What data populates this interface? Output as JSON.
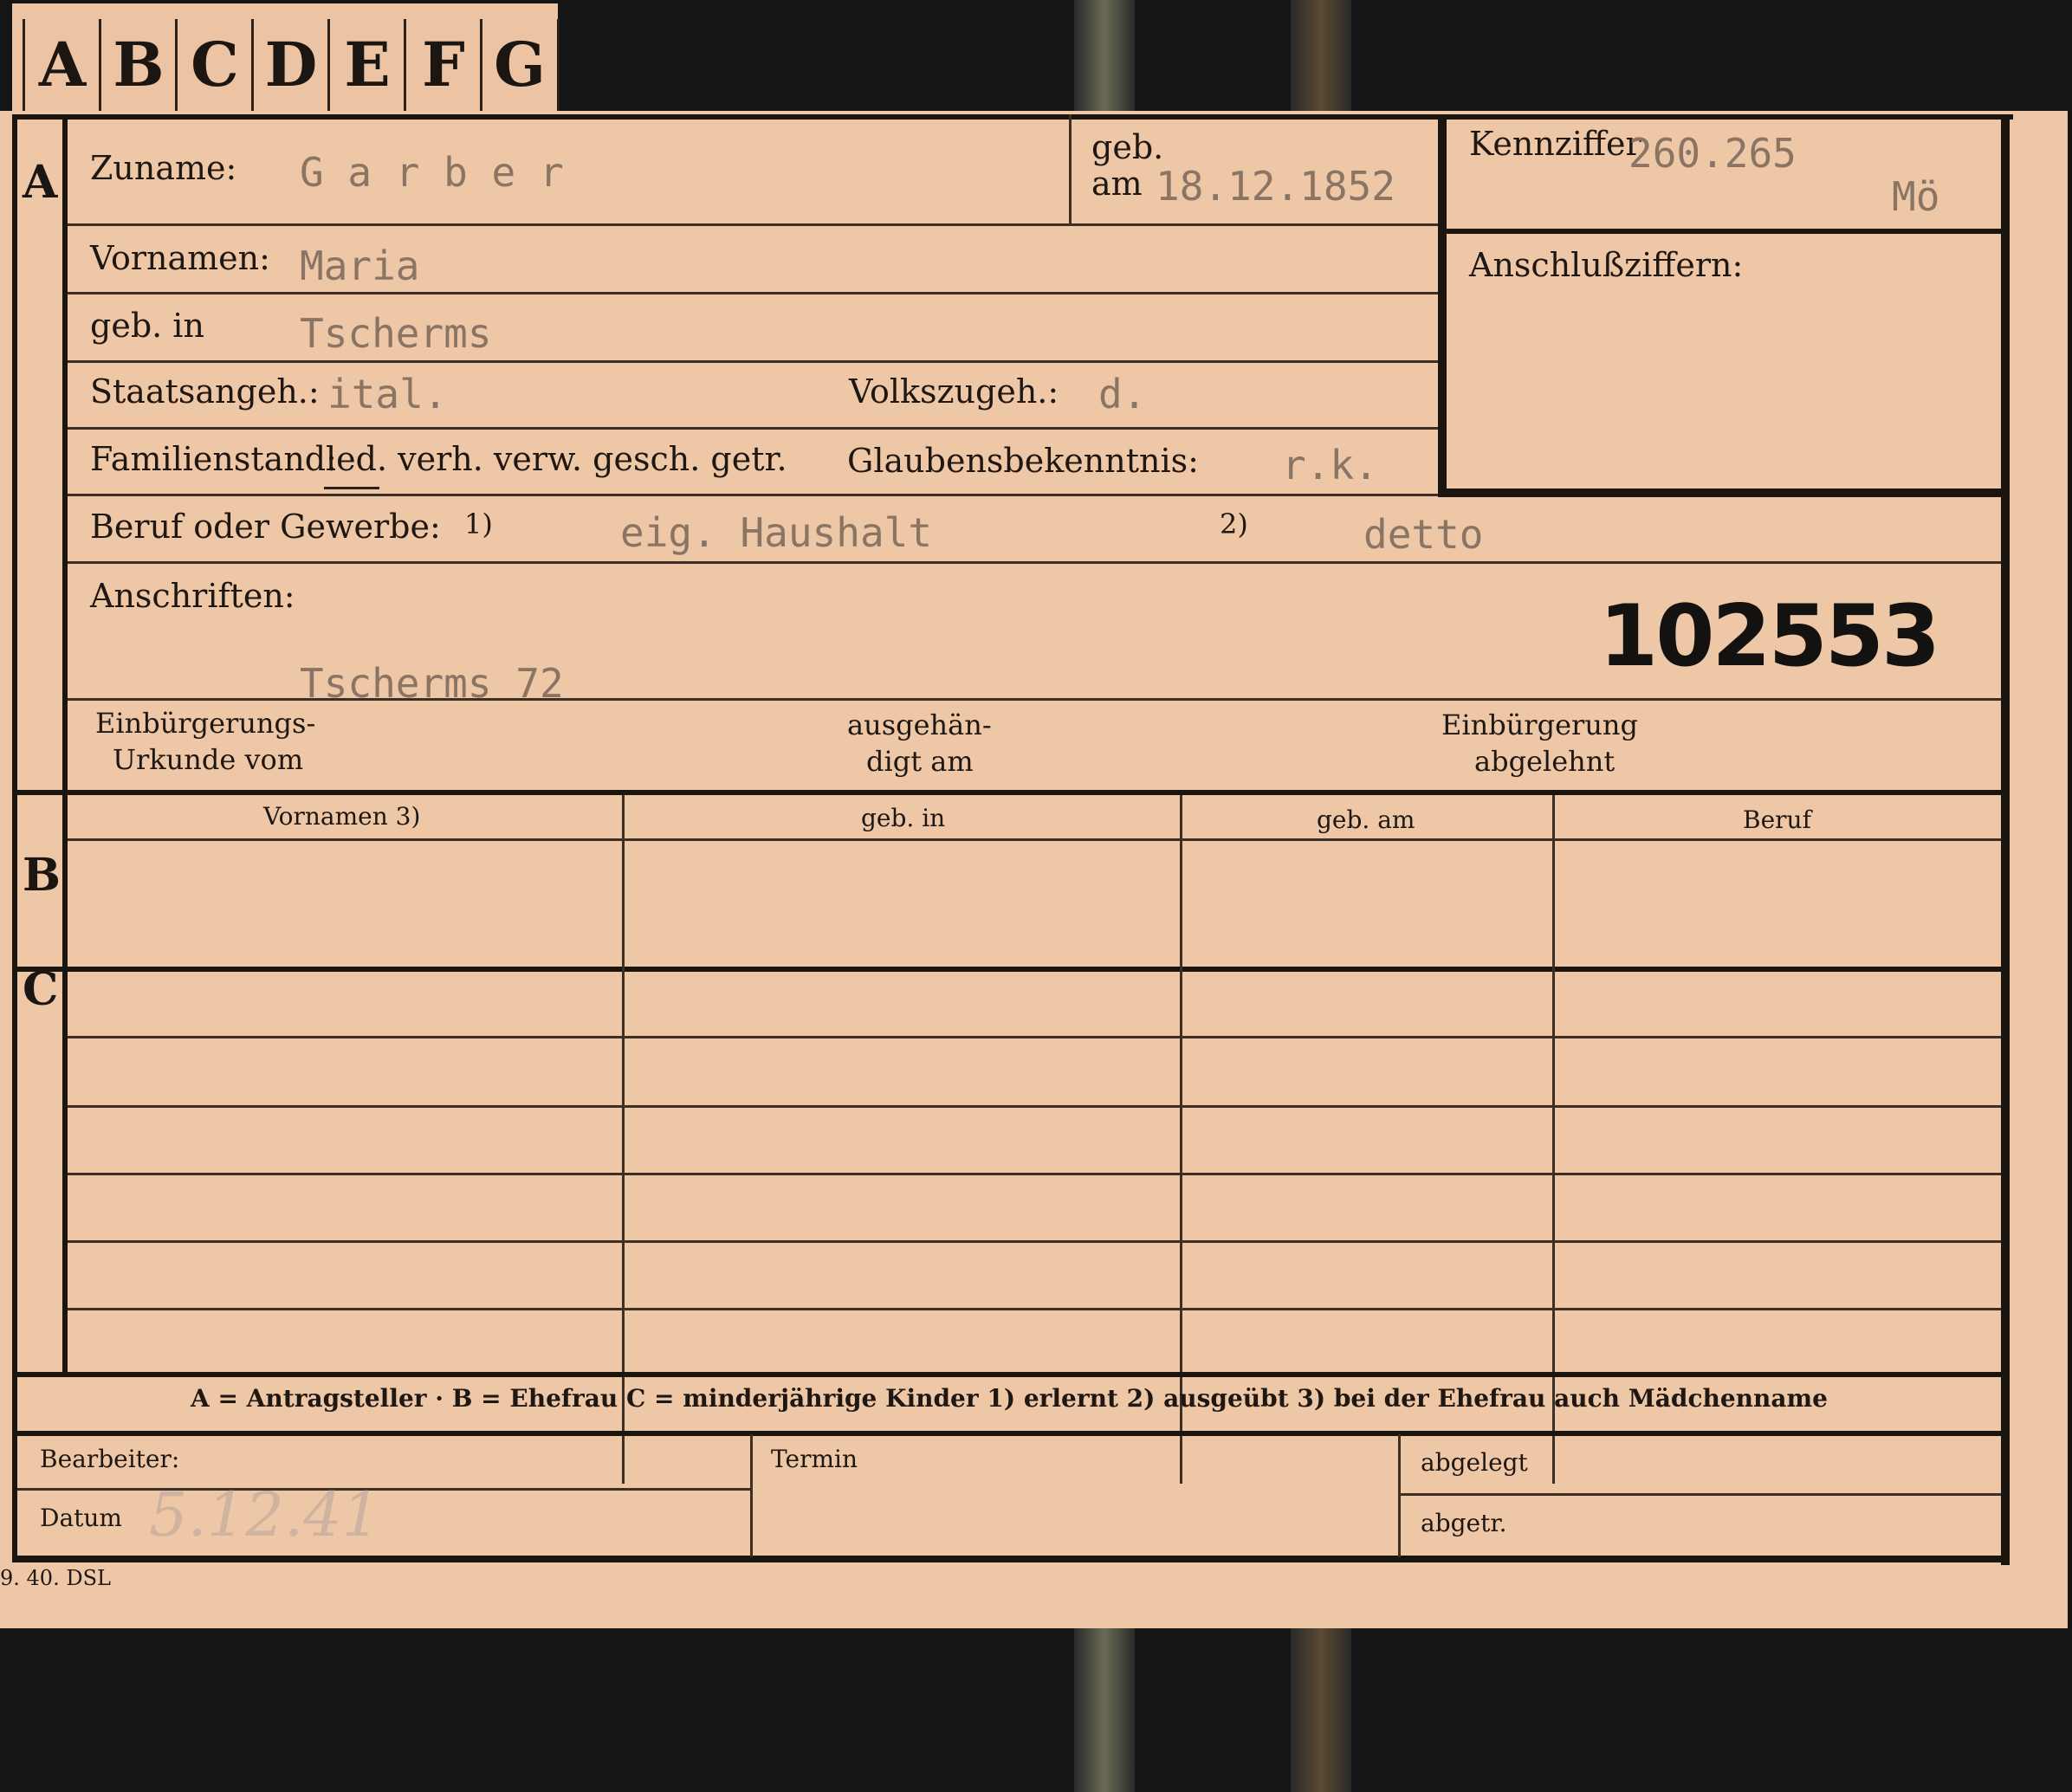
{
  "tabs": [
    "A",
    "B",
    "C",
    "D",
    "E",
    "F",
    "G"
  ],
  "sections": {
    "a": "A",
    "b": "B",
    "c": "C"
  },
  "fields": {
    "zuname_label": "Zuname:",
    "zuname_value": "G a r b e r",
    "geb_label": "geb.",
    "am_label": "am",
    "geb_am_value": "18.12.1852",
    "kennziffer_label": "Kennziffer",
    "kennziffer_value": "260.265",
    "kennziffer_note": "Mö",
    "anschluss_label": "Anschlußziffern:",
    "vornamen_label": "Vornamen:",
    "vornamen_value": "Maria",
    "geb_in_label": "geb. in",
    "geb_in_value": "Tscherms",
    "staats_label": "Staatsangeh.:",
    "staats_value": "ital.",
    "volks_label": "Volkszugeh.:",
    "volks_value": "d.",
    "familien_label": "Familienstand:",
    "familien_options": "led. verh. verw. gesch. getr.",
    "glaubens_label": "Glaubensbekenntnis:",
    "glaubens_value": "r.k.",
    "beruf_label": "Beruf oder Gewerbe:",
    "beruf_mark1": "1)",
    "beruf_value1": "eig. Haushalt",
    "beruf_mark2": "2)",
    "beruf_value2": "detto",
    "anschriften_label": "Anschriften:",
    "anschriften_value": "Tscherms 72",
    "stamp_number": "102553",
    "einb_urkunde_line1": "Einbürgerungs-",
    "einb_urkunde_line2": "Urkunde vom",
    "ausgehaend_line1": "ausgehän-",
    "ausgehaend_line2": "digt am",
    "einb_abgelehnt_line1": "Einbürgerung",
    "einb_abgelehnt_line2": "abgelehnt"
  },
  "table": {
    "headers": [
      "Vornamen 3)",
      "geb. in",
      "geb. am",
      "Beruf"
    ]
  },
  "legend": "A = Antragsteller · B = Ehefrau   C = minderjährige Kinder   1) erlernt   2) ausgeübt   3) bei der Ehefrau auch Mädchenname",
  "footer": {
    "bearbeiter_label": "Bearbeiter:",
    "datum_label": "Datum",
    "datum_value": "5.12.41",
    "termin_label": "Termin",
    "abgelegt_label": "abgelegt",
    "abgetr_label": "abgetr."
  },
  "print_code": "9. 40. DSL",
  "colors": {
    "card": "#eec7a7",
    "ink": "#1c1612",
    "typewriter": "#8a7565",
    "background": "#151515"
  }
}
